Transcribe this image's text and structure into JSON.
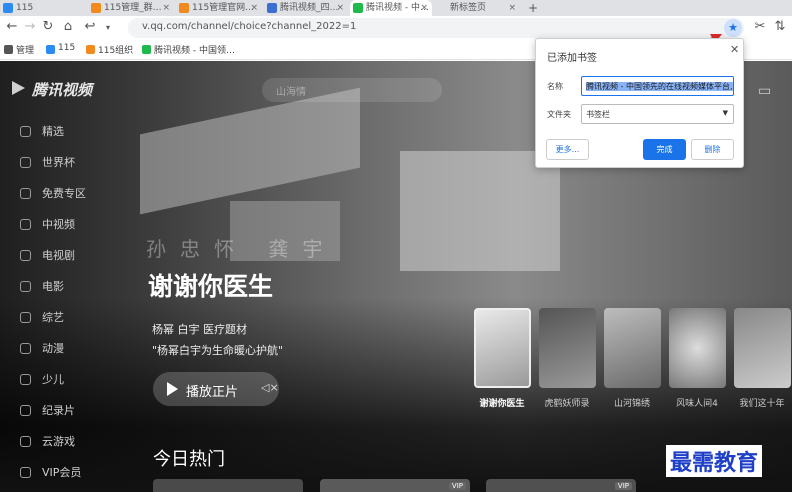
{
  "tabs": [
    {
      "label": "115",
      "icon_color": "#2a8bf2",
      "active": false
    },
    {
      "label": "115管理_群…",
      "icon_color": "#f28a1e",
      "active": false
    },
    {
      "label": "115管理官网…",
      "icon_color": "#f28a1e",
      "active": false
    },
    {
      "label": "腾讯视频_四…",
      "icon_color": "#3b6fd1",
      "active": false
    },
    {
      "label": "腾讯视频 - 中…",
      "icon_color": "#1fba4c",
      "active": true
    },
    {
      "label": "新标签页",
      "icon_color": "#cccccc",
      "active": false
    }
  ],
  "new_tab_label": "+",
  "address": {
    "url": "v.qq.com/channel/choice?channel_2022=1"
  },
  "bookmarks": [
    {
      "label": "管理",
      "icon_color": "#555555"
    },
    {
      "label": "115",
      "icon_color": "#2a8bf2"
    },
    {
      "label": "115组织",
      "icon_color": "#f28a1e"
    },
    {
      "label": "腾讯视频 - 中国领…",
      "icon_color": "#1fba4c"
    }
  ],
  "site": {
    "logo": "腾讯视频",
    "search_placeholder": "山海情",
    "sidebar": [
      "精选",
      "世界杯",
      "免费专区",
      "中视频",
      "电视剧",
      "电影",
      "综艺",
      "动漫",
      "少儿",
      "纪录片",
      "云游戏",
      "VIP会员"
    ]
  },
  "hero": {
    "title": "谢谢你医生",
    "ghost_text": "孙忠怀 龚宇",
    "cast": "杨幂 白宇 医疗题材",
    "quote": "\"杨幂白宇为生命暖心护航\"",
    "play_label": "播放正片",
    "mute_icon": "volume-mute-icon"
  },
  "thumbs": [
    "谢谢你医生",
    "虎鹤妖师录",
    "山河锦绣",
    "风味人间4",
    "我们这十年"
  ],
  "section": {
    "hot_title": "今日热门",
    "vip_badge": "VIP"
  },
  "watermark": "最需教育",
  "popup": {
    "title": "已添加书签",
    "name_label": "名称",
    "name_value": "腾讯视频 - 中国领先的在线视频媒体平台,",
    "folder_label": "文件夹",
    "folder_value": "书签栏",
    "more_label": "更多...",
    "done_label": "完成",
    "remove_label": "删除"
  },
  "colors": {
    "accent": "#1a73e8",
    "arrow": "#d92a2a"
  }
}
